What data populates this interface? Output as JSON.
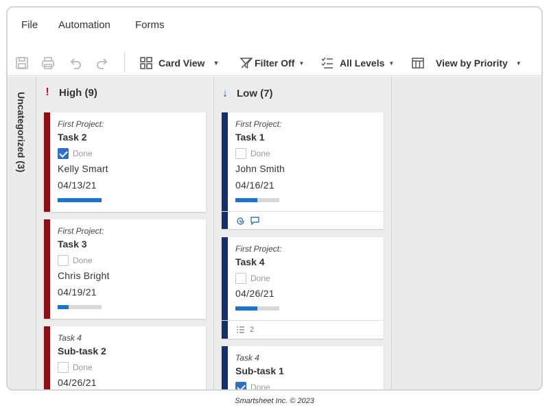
{
  "menu": {
    "file": "File",
    "automation": "Automation",
    "forms": "Forms"
  },
  "toolbar": {
    "save_icon": "save-icon",
    "print_icon": "print-icon",
    "undo_icon": "undo-icon",
    "redo_icon": "redo-icon",
    "card_view": "Card View",
    "filter": "Filter Off",
    "levels": "All Levels",
    "view_by": "View by Priority"
  },
  "lanes": {
    "uncategorized": "Uncategorized (3)",
    "high": {
      "label": "High (9)",
      "icon": "!",
      "color": "#c0141a"
    },
    "low": {
      "label": "Low (7)",
      "icon": "↓",
      "color": "#1a6fc4"
    }
  },
  "cards": {
    "high": [
      {
        "parent": "First Project:",
        "title": "Task 2",
        "done_label": "Done",
        "done": true,
        "assignee": "Kelly Smart",
        "date": "04/13/21",
        "progress": 1.0
      },
      {
        "parent": "First Project:",
        "title": "Task 3",
        "done_label": "Done",
        "done": false,
        "assignee": "Chris Bright",
        "date": "04/19/21",
        "progress": 0.25
      },
      {
        "parent": "Task 4",
        "title": "Sub-task 2",
        "done_label": "Done",
        "done": false,
        "date": "04/26/21"
      }
    ],
    "low": [
      {
        "parent": "First Project:",
        "title": "Task 1",
        "done_label": "Done",
        "done": false,
        "assignee": "John Smith",
        "date": "04/16/21",
        "progress": 0.5,
        "footer_icons": [
          "attachment-icon",
          "comment-icon"
        ]
      },
      {
        "parent": "First Project:",
        "title": "Task 4",
        "done_label": "Done",
        "done": false,
        "date": "04/26/21",
        "progress": 0.5,
        "footer_icons": [
          "subtasks-icon"
        ],
        "subtask_count": "2"
      },
      {
        "parent": "Task 4",
        "title": "Sub-task 1",
        "done_label": "Done",
        "done": true
      }
    ]
  },
  "colors": {
    "high_stripe": "#8b1014",
    "low_stripe": "#13306e",
    "progress": "#1a73cf"
  },
  "credit": "Smartsheet Inc. © 2023"
}
